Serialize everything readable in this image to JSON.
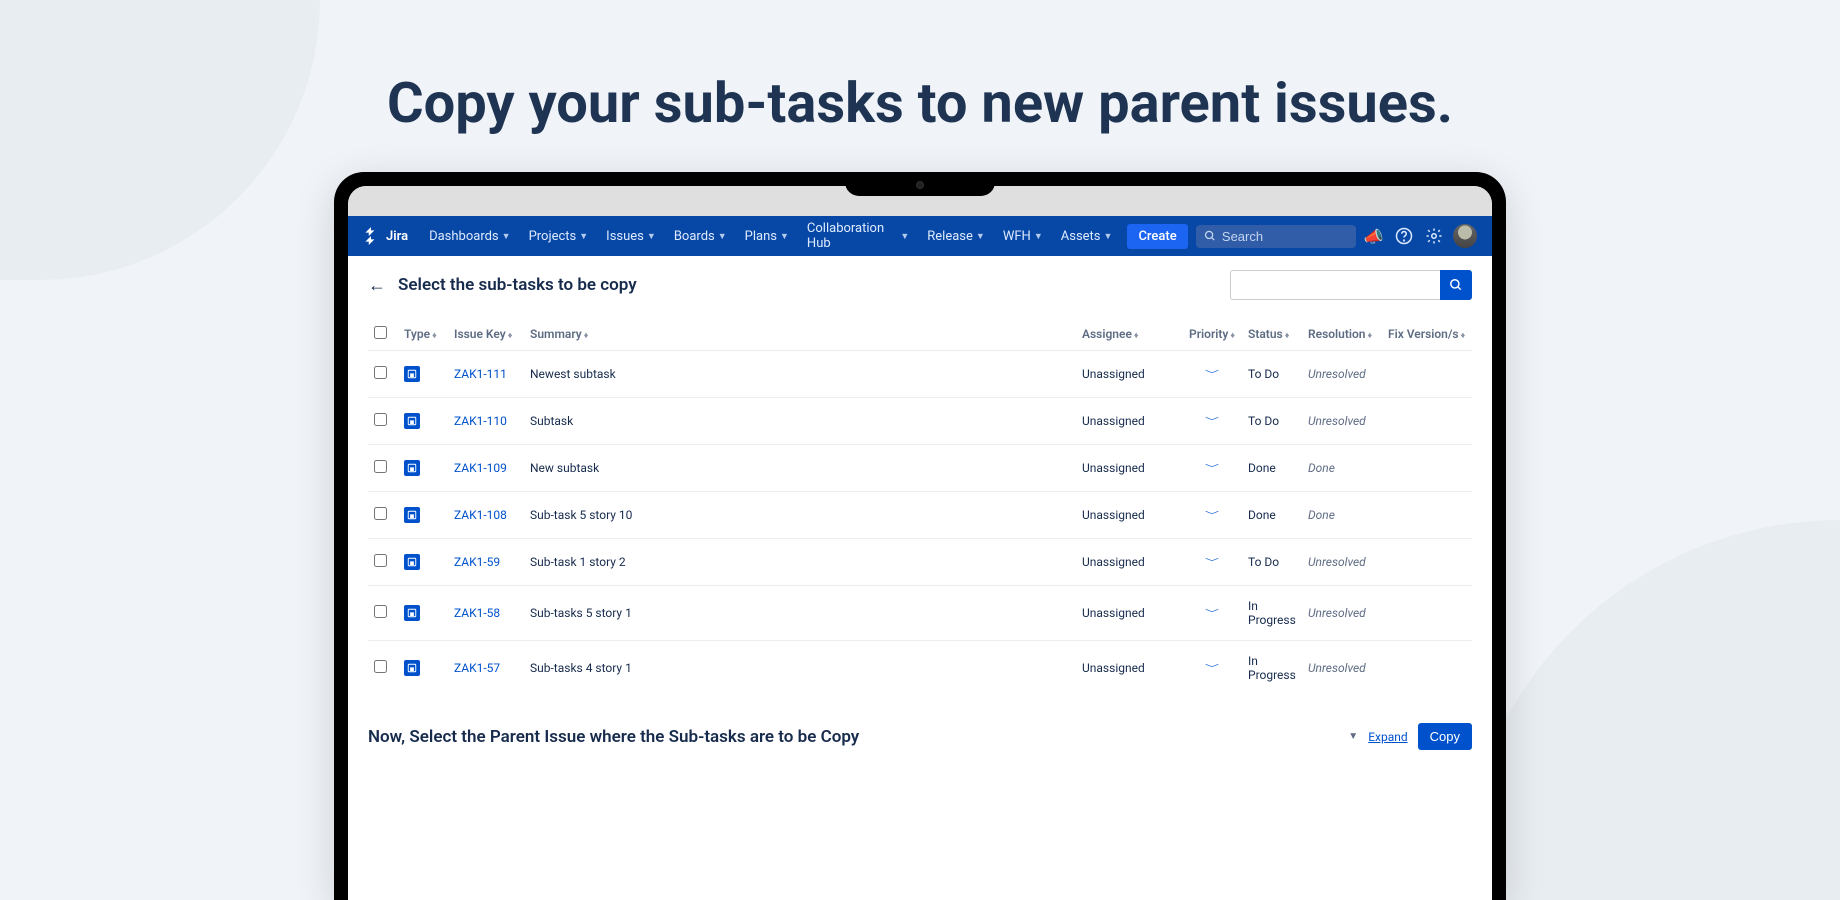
{
  "hero": {
    "title": "Copy your sub-tasks to new parent issues."
  },
  "app_name": "Jira",
  "nav": {
    "items": [
      "Dashboards",
      "Projects",
      "Issues",
      "Boards",
      "Plans",
      "Collaboration Hub",
      "Release",
      "WFH",
      "Assets"
    ],
    "create": "Create",
    "search_placeholder": "Search"
  },
  "page": {
    "title": "Select the sub-tasks to be copy",
    "footer_title": "Now, Select the Parent Issue where the Sub-tasks are to be Copy",
    "expand": "Expand",
    "copy": "Copy"
  },
  "columns": [
    "Type",
    "Issue Key",
    "Summary",
    "Assignee",
    "Priority",
    "Status",
    "Resolution",
    "Fix Version/s"
  ],
  "rows": [
    {
      "key": "ZAK1-111",
      "summary": "Newest subtask",
      "assignee": "Unassigned",
      "status": "To Do",
      "resolution": "Unresolved"
    },
    {
      "key": "ZAK1-110",
      "summary": "Subtask",
      "assignee": "Unassigned",
      "status": "To Do",
      "resolution": "Unresolved"
    },
    {
      "key": "ZAK1-109",
      "summary": "New subtask",
      "assignee": "Unassigned",
      "status": "Done",
      "resolution": "Done"
    },
    {
      "key": "ZAK1-108",
      "summary": "Sub-task 5 story 10",
      "assignee": "Unassigned",
      "status": "Done",
      "resolution": "Done"
    },
    {
      "key": "ZAK1-59",
      "summary": "Sub-task 1 story 2",
      "assignee": "Unassigned",
      "status": "To Do",
      "resolution": "Unresolved"
    },
    {
      "key": "ZAK1-58",
      "summary": "Sub-tasks 5 story 1",
      "assignee": "Unassigned",
      "status": "In Progress",
      "resolution": "Unresolved"
    },
    {
      "key": "ZAK1-57",
      "summary": "Sub-tasks 4 story 1",
      "assignee": "Unassigned",
      "status": "In Progress",
      "resolution": "Unresolved"
    }
  ]
}
